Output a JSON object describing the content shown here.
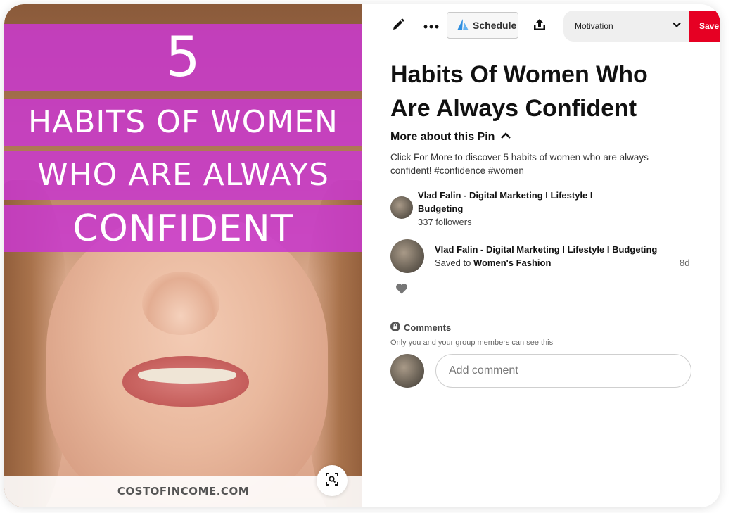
{
  "colors": {
    "accent": "#e60023",
    "banner": "#c83acc",
    "text": "#111111",
    "muted": "#666666"
  },
  "pin_image": {
    "number": "5",
    "banner_lines": [
      "HABITS OF WOMEN",
      "WHO ARE ALWAYS",
      "CONFIDENT"
    ],
    "site": "COSTOFINCOME.COM"
  },
  "toolbar": {
    "edit_icon": "pencil-icon",
    "more_icon": "more-dots-icon",
    "schedule_label": "Schedule",
    "share_icon": "upload-icon",
    "board_value": "Motivation",
    "save_label": "Save"
  },
  "pin": {
    "title": "Habits Of Women Who Are Always Confident",
    "more_about_label": "More about this Pin",
    "description": "Click For More to discover 5 habits of women who are always confident! #confidence #women"
  },
  "creator": {
    "name": "Vlad Falin - Digital Marketing I Lifestyle I Budgeting",
    "followers": "337 followers"
  },
  "activity": {
    "name": "Vlad Falin - Digital Marketing I Lifestyle I Budgeting",
    "saved_prefix": "Saved to",
    "board": "Women's Fashion",
    "time": "8d"
  },
  "comments": {
    "title": "Comments",
    "note": "Only you and your group members can see this",
    "placeholder": "Add comment"
  }
}
